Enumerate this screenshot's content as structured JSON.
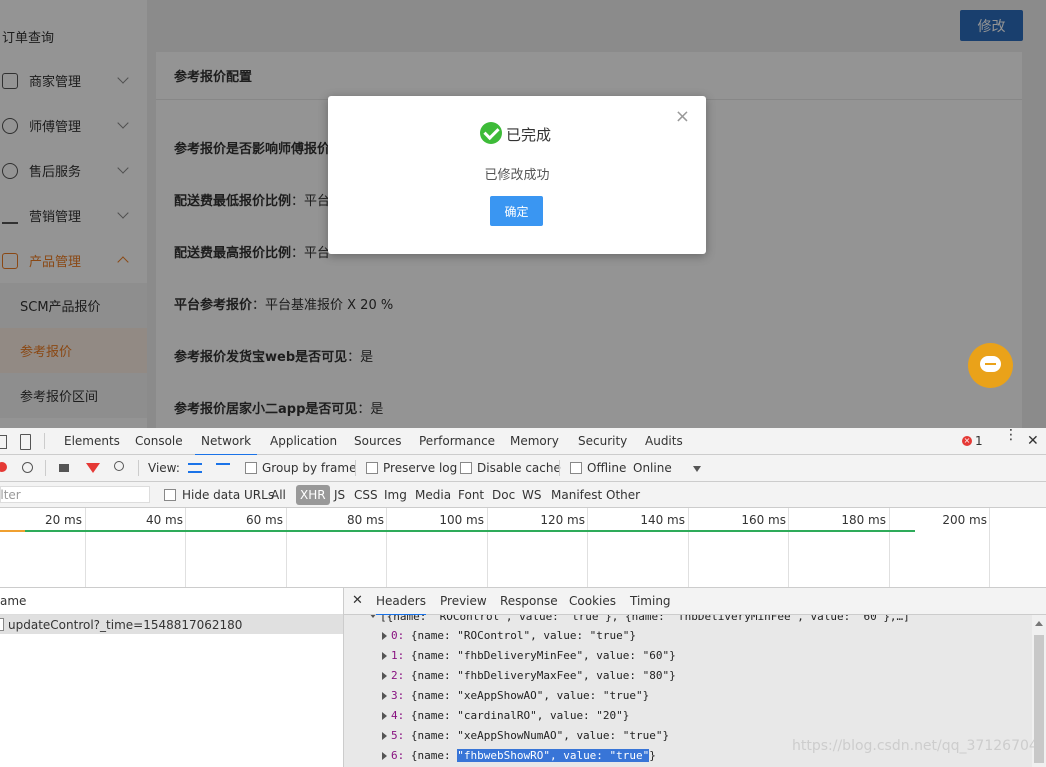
{
  "sidebar": {
    "top_item": "订单查询",
    "groups": [
      {
        "label": "商家管理",
        "icon": "store-icon"
      },
      {
        "label": "师傅管理",
        "icon": "user-icon"
      },
      {
        "label": "售后服务",
        "icon": "service-icon"
      },
      {
        "label": "营销管理",
        "icon": "chart-icon"
      },
      {
        "label": "产品管理",
        "icon": "grid-icon"
      }
    ],
    "sub_items": [
      "SCM产品报价",
      "参考报价",
      "参考报价区间"
    ]
  },
  "header": {
    "save_label": "修改"
  },
  "card": {
    "title": "参考报价配置",
    "rows": [
      {
        "label": "参考报价是否影响师傅报价",
        "value": ""
      },
      {
        "label": "配送费最低报价比例",
        "value": "：平台"
      },
      {
        "label": "配送费最高报价比例",
        "value": "：平台"
      },
      {
        "label": "平台参考报价",
        "value": "：平台基准报价 X 20 %"
      },
      {
        "label": "参考报价发货宝web是否可见",
        "value": "：是"
      },
      {
        "label": "参考报价居家小二app是否可见",
        "value": "：是"
      }
    ]
  },
  "dialog": {
    "title": "已完成",
    "message": "已修改成功",
    "ok_label": "确定",
    "close": "×"
  },
  "devtools": {
    "tabs": [
      "Elements",
      "Console",
      "Network",
      "Application",
      "Sources",
      "Performance",
      "Memory",
      "Security",
      "Audits"
    ],
    "active_tab": "Network",
    "error_count": "1",
    "toolbar": {
      "view_label": "View:",
      "group_by_frame": "Group by frame",
      "preserve_log": "Preserve log",
      "disable_cache": "Disable cache",
      "offline": "Offline",
      "online": "Online"
    },
    "filter": {
      "placeholder": "Filter",
      "hide_data_urls": "Hide data URLs",
      "types": [
        "All",
        "XHR",
        "JS",
        "CSS",
        "Img",
        "Media",
        "Font",
        "Doc",
        "WS",
        "Manifest",
        "Other"
      ],
      "active_type": "XHR"
    },
    "timeline_ticks": [
      "20 ms",
      "40 ms",
      "60 ms",
      "80 ms",
      "100 ms",
      "120 ms",
      "140 ms",
      "160 ms",
      "180 ms",
      "200 ms"
    ],
    "name_header": "ame",
    "request_name": "updateControl?_time=1548817062180",
    "detail_tabs": [
      "Headers",
      "Preview",
      "Response",
      "Cookies",
      "Timing"
    ],
    "active_detail_tab": "Headers",
    "payload_summary": "[{name: \"ROControl\", value: \"true\"}, {name: \"fhbDeliveryMinFee\", value: \"60\"},…]",
    "payload_items": [
      {
        "index": "0:",
        "text": "{name: \"ROControl\", value: \"true\"}"
      },
      {
        "index": "1:",
        "text": "{name: \"fhbDeliveryMinFee\", value: \"60\"}"
      },
      {
        "index": "2:",
        "text": "{name: \"fhbDeliveryMaxFee\", value: \"80\"}"
      },
      {
        "index": "3:",
        "text": "{name: \"xeAppShowAO\", value: \"true\"}"
      },
      {
        "index": "4:",
        "text": "{name: \"cardinalRO\", value: \"20\"}"
      },
      {
        "index": "5:",
        "text": "{name: \"xeAppShowNumAO\", value: \"true\"}"
      },
      {
        "index": "6:",
        "text_pre": "{name: ",
        "text_hl": "\"fhbwebShowRO\", value: \"true\"",
        "text_post": "}"
      }
    ],
    "watermark": "https://blog.csdn.net/qq_37126704"
  }
}
